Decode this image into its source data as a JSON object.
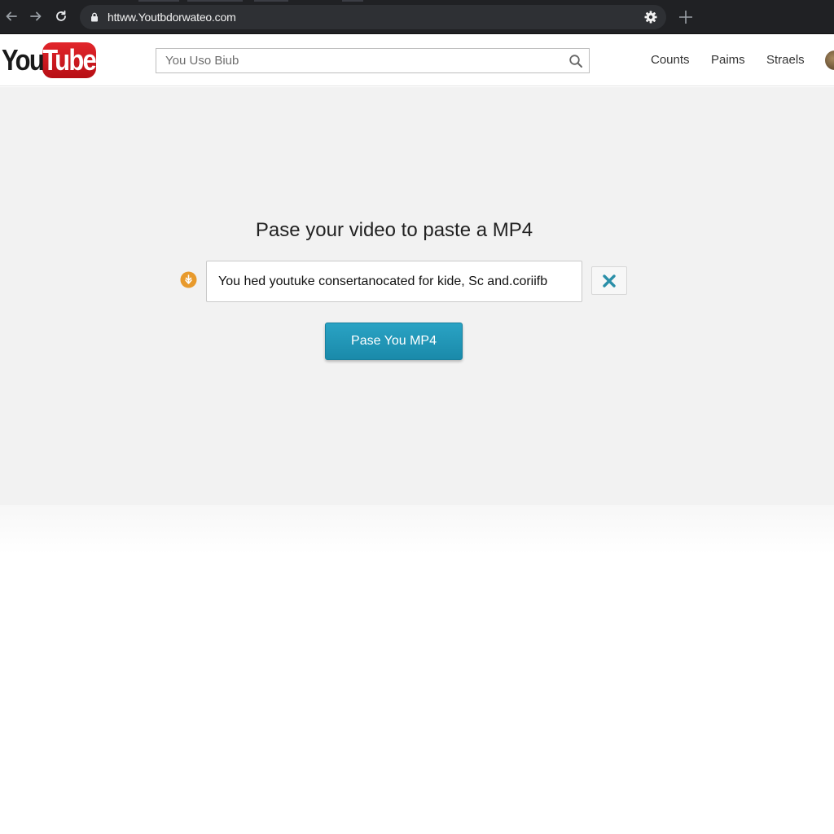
{
  "browser": {
    "url": "httww.Youtbdorwateo.com",
    "icons": [
      "back-arrow-icon",
      "forward-arrow-icon",
      "reload-icon",
      "lock-icon",
      "settings-icon",
      "new-tab-icon"
    ]
  },
  "header": {
    "logo_you": "You",
    "logo_tube": "Tube",
    "search_placeholder": "You Uso Biub",
    "links": [
      "Counts",
      "Paims",
      "Straels"
    ]
  },
  "converter": {
    "headline": "Pase your video to paste a MP4",
    "url_value": "You hed youtuke consertanocated for kide, Sc and.coriifb",
    "convert_label": "Pase You MP4"
  },
  "colors": {
    "accent": "#1f95b7",
    "logo_red": "#d2141b",
    "url_icon": "#e89a2c",
    "clear_icon": "#2a8fa8"
  }
}
